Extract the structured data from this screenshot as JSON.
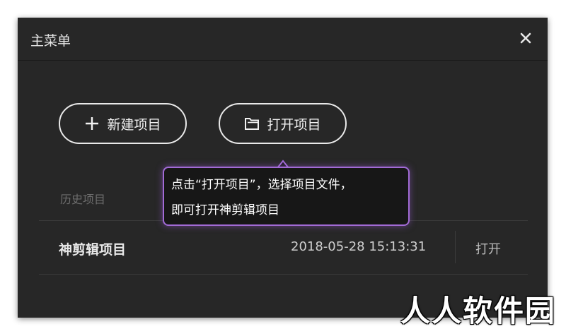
{
  "dialog": {
    "title": "主菜单",
    "close_icon": "close-icon"
  },
  "actions": {
    "new_project": {
      "label": "新建项目",
      "icon": "plus-icon"
    },
    "open_project": {
      "label": "打开项目",
      "icon": "folder-icon"
    }
  },
  "tooltip": {
    "line1": "点击“打开项目”，选择项目文件，",
    "line2": "即可打开神剪辑项目",
    "border_color": "#a26bd6"
  },
  "history": {
    "label": "历史项目",
    "items": [
      {
        "name": "神剪辑项目",
        "date": "2018-05-28 15:13:31",
        "action": "打开"
      }
    ]
  },
  "watermark": "人人软件园"
}
